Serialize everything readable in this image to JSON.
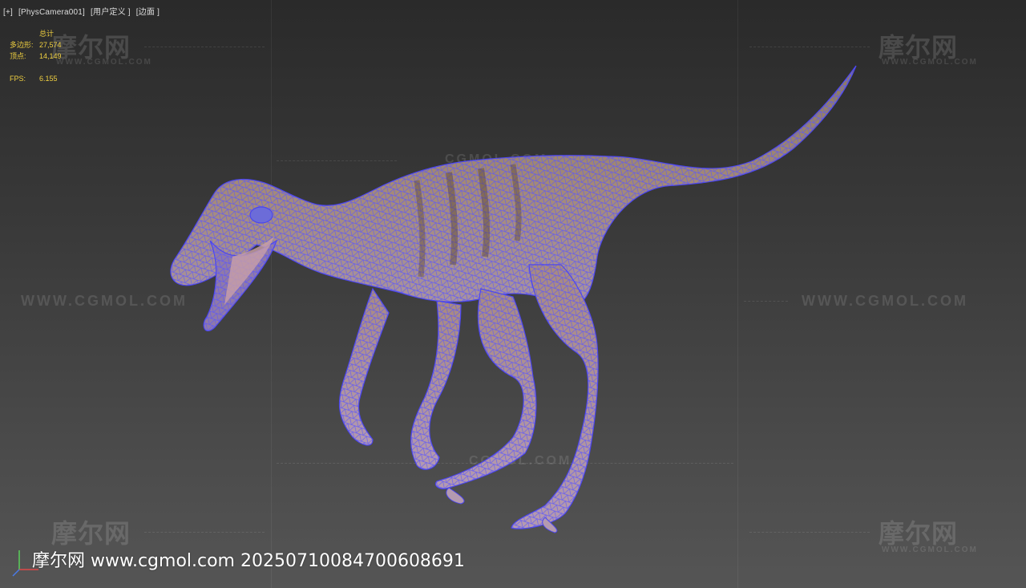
{
  "viewport": {
    "label_parts": [
      "[+]",
      "[PhysCamera001]",
      "[用户定义 ]",
      "[边面 ]"
    ]
  },
  "stats": {
    "header": "总计",
    "polygons_label": "多边形:",
    "polygons_value": "27,574",
    "vertices_label": "顶点:",
    "vertices_value": "14,149",
    "fps_label": "FPS:",
    "fps_value": "6.155"
  },
  "watermarks": {
    "logo_text": "摩尔网",
    "logo_sub": "WWW.CGMOL.COM",
    "url_text": "WWW.CGMOL.COM",
    "mid_text": "CGMOL.COM",
    "bottom_text": "摩尔网 www.cgmol.com 20250710084700608691"
  },
  "colors": {
    "stats_text": "#f0d040",
    "wireframe": "#5a55ff",
    "model_skin": "#a88a78"
  },
  "icons": {
    "axis_gizmo": "axis-gizmo-icon"
  }
}
